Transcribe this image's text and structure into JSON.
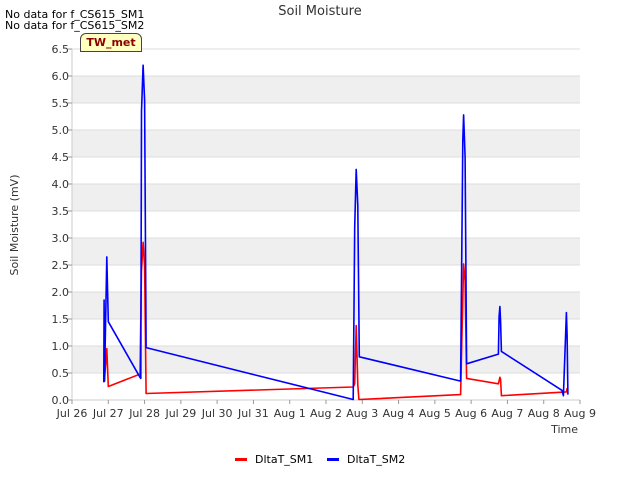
{
  "notes": [
    "No data for f_CS615_SM1",
    "No data for f_CS615_SM2"
  ],
  "site_label": "TW_met",
  "chart_data": {
    "type": "line",
    "title": "Soil Moisture",
    "xlabel": "Time",
    "ylabel": "Soil Moisture (mV)",
    "ylim": [
      0.0,
      6.5
    ],
    "yticks": [
      0.0,
      0.5,
      1.0,
      1.5,
      2.0,
      2.5,
      3.0,
      3.5,
      4.0,
      4.5,
      5.0,
      5.5,
      6.0,
      6.5
    ],
    "ytick_labels": [
      "0.0",
      "0.5",
      "1.0",
      "1.5",
      "2.0",
      "2.5",
      "3.0",
      "3.5",
      "4.0",
      "4.5",
      "5.0",
      "5.5",
      "6.0",
      "6.5"
    ],
    "xlim": [
      "2024-07-26",
      "2024-08-09"
    ],
    "xticks": [
      "2024-07-26",
      "2024-07-27",
      "2024-07-28",
      "2024-07-29",
      "2024-07-30",
      "2024-07-31",
      "2024-08-01",
      "2024-08-02",
      "2024-08-03",
      "2024-08-04",
      "2024-08-05",
      "2024-08-06",
      "2024-08-07",
      "2024-08-08",
      "2024-08-09"
    ],
    "xtick_labels": [
      "Jul 26",
      "Jul 27",
      "Jul 28",
      "Jul 29",
      "Jul 30",
      "Jul 31",
      "Aug 1",
      "Aug 2",
      "Aug 3",
      "Aug 4",
      "Aug 5",
      "Aug 6",
      "Aug 7",
      "Aug 8",
      "Aug 9"
    ],
    "grid": "horizontal bands",
    "legend_position": "bottom-center",
    "series": [
      {
        "name": "DltaT_SM1",
        "color": "#ff0000",
        "points": [
          [
            "2024-07-26 21:00",
            0.33
          ],
          [
            "2024-07-26 21:15",
            0.6
          ],
          [
            "2024-07-26 21:25",
            0.35
          ],
          [
            "2024-07-26 23:00",
            0.95
          ],
          [
            "2024-07-27 00:00",
            0.25
          ],
          [
            "2024-07-27 21:00",
            0.48
          ],
          [
            "2024-07-27 22:00",
            2.4
          ],
          [
            "2024-07-27 23:00",
            2.92
          ],
          [
            "2024-07-28 00:00",
            2.5
          ],
          [
            "2024-07-28 01:00",
            0.12
          ],
          [
            "2024-08-02 18:00",
            0.24
          ],
          [
            "2024-08-02 19:00",
            0.3
          ],
          [
            "2024-08-02 20:00",
            1.38
          ],
          [
            "2024-08-02 21:00",
            0.28
          ],
          [
            "2024-08-02 21:45",
            0.01
          ],
          [
            "2024-08-05 17:00",
            0.1
          ],
          [
            "2024-08-05 19:00",
            2.52
          ],
          [
            "2024-08-05 20:00",
            2.2
          ],
          [
            "2024-08-05 21:00",
            0.4
          ],
          [
            "2024-08-06 18:00",
            0.3
          ],
          [
            "2024-08-06 19:00",
            0.42
          ],
          [
            "2024-08-06 19:30",
            0.38
          ],
          [
            "2024-08-06 20:00",
            0.08
          ],
          [
            "2024-08-08 15:00",
            0.15
          ],
          [
            "2024-08-08 15:30",
            0.22
          ]
        ]
      },
      {
        "name": "DltaT_SM2",
        "color": "#0000ff",
        "points": [
          [
            "2024-07-26 21:00",
            0.33
          ],
          [
            "2024-07-26 21:15",
            1.85
          ],
          [
            "2024-07-26 21:30",
            0.35
          ],
          [
            "2024-07-26 23:00",
            2.65
          ],
          [
            "2024-07-27 00:00",
            1.45
          ],
          [
            "2024-07-27 21:00",
            0.42
          ],
          [
            "2024-07-27 21:30",
            0.4
          ],
          [
            "2024-07-27 22:00",
            5.35
          ],
          [
            "2024-07-27 23:00",
            6.2
          ],
          [
            "2024-07-28 00:00",
            5.55
          ],
          [
            "2024-07-28 01:00",
            0.97
          ],
          [
            "2024-08-02 18:00",
            0.01
          ],
          [
            "2024-08-02 19:00",
            3.2
          ],
          [
            "2024-08-02 20:00",
            4.27
          ],
          [
            "2024-08-02 21:00",
            3.6
          ],
          [
            "2024-08-02 22:00",
            0.8
          ],
          [
            "2024-08-05 17:00",
            0.35
          ],
          [
            "2024-08-05 18:30",
            4.8
          ],
          [
            "2024-08-05 19:00",
            5.28
          ],
          [
            "2024-08-05 20:00",
            4.5
          ],
          [
            "2024-08-05 21:00",
            0.67
          ],
          [
            "2024-08-06 18:00",
            0.85
          ],
          [
            "2024-08-06 18:30",
            1.55
          ],
          [
            "2024-08-06 19:00",
            1.73
          ],
          [
            "2024-08-06 19:30",
            1.45
          ],
          [
            "2024-08-06 20:00",
            0.9
          ],
          [
            "2024-08-08 12:00",
            0.18
          ],
          [
            "2024-08-08 13:00",
            0.08
          ],
          [
            "2024-08-08 15:00",
            1.62
          ],
          [
            "2024-08-08 15:30",
            1.2
          ],
          [
            "2024-08-08 16:00",
            0.1
          ]
        ]
      }
    ]
  }
}
